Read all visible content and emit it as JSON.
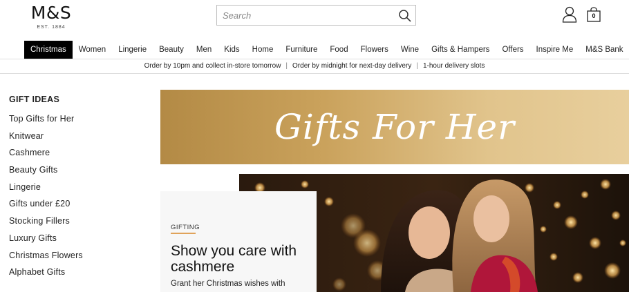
{
  "brand": {
    "name": "M&S",
    "est": "EST. 1884"
  },
  "search": {
    "placeholder": "Search"
  },
  "header": {
    "bag_count": "0"
  },
  "nav": {
    "items": [
      {
        "label": "Christmas",
        "active": true
      },
      {
        "label": "Women"
      },
      {
        "label": "Lingerie"
      },
      {
        "label": "Beauty"
      },
      {
        "label": "Men"
      },
      {
        "label": "Kids"
      },
      {
        "label": "Home"
      },
      {
        "label": "Furniture"
      },
      {
        "label": "Food"
      },
      {
        "label": "Flowers"
      },
      {
        "label": "Wine"
      },
      {
        "label": "Gifts & Hampers"
      },
      {
        "label": "Offers"
      },
      {
        "label": "Inspire Me"
      },
      {
        "label": "M&S Bank"
      }
    ]
  },
  "delivery": {
    "messages": [
      "Order by 10pm and collect in-store tomorrow",
      "Order by midnight for next-day delivery",
      "1-hour delivery slots"
    ],
    "separator": "|"
  },
  "sidebar": {
    "title": "GIFT IDEAS",
    "items": [
      {
        "label": "Top Gifts for Her"
      },
      {
        "label": "Knitwear"
      },
      {
        "label": "Cashmere"
      },
      {
        "label": "Beauty Gifts"
      },
      {
        "label": "Lingerie"
      },
      {
        "label": "Gifts under £20"
      },
      {
        "label": "Stocking Fillers"
      },
      {
        "label": "Luxury Gifts"
      },
      {
        "label": "Christmas Flowers"
      },
      {
        "label": "Alphabet Gifts"
      }
    ]
  },
  "banner": {
    "title": "Gifts For Her"
  },
  "promo": {
    "tag": "GIFTING",
    "title": "Show you care with cashmere",
    "subtitle": "Grant her Christmas wishes with"
  },
  "colors": {
    "accent": "#e0a35a",
    "banner_gold": "#caa25c",
    "nav_active": "#000000"
  }
}
